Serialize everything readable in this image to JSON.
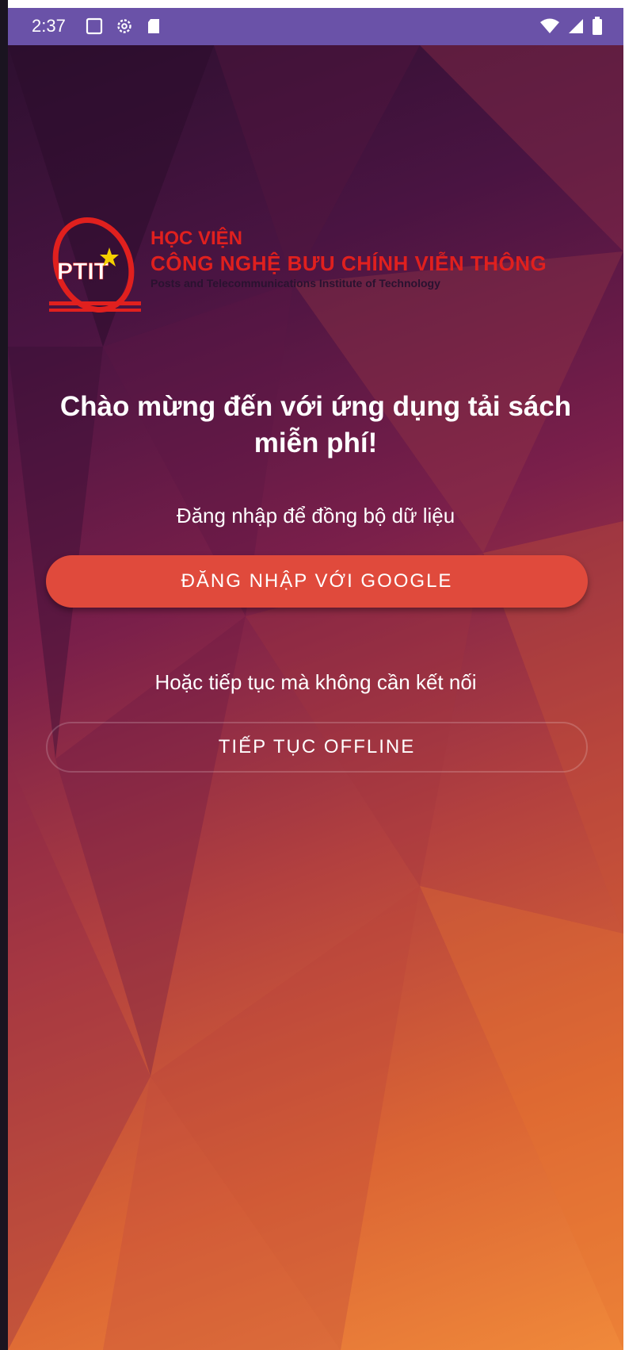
{
  "status_bar": {
    "time": "2:37",
    "left_icons": [
      "screenshot-icon",
      "settings-icon",
      "sd-card-icon"
    ],
    "right_icons": [
      "wifi-icon",
      "signal-icon",
      "battery-icon"
    ],
    "color": "#6a52a8"
  },
  "logo": {
    "mark": "PTIT",
    "line1": "HỌC VIỆN",
    "line2": "CÔNG NGHỆ BƯU CHÍNH VIỄN THÔNG",
    "line3": "Posts and Telecommunications Institute of Technology",
    "color": "#e0201e"
  },
  "welcome": {
    "title": "Chào mừng đến với ứng dụng tải sách miễn phí!",
    "login_prompt": "Đăng nhập để đồng bộ dữ liệu",
    "google_button": "ĐĂNG NHẬP VỚI GOOGLE",
    "offline_prompt": "Hoặc tiếp tục mà không cần kết nối",
    "offline_button": "TIẾP TỤC OFFLINE"
  },
  "colors": {
    "google_button": "#e04a3c",
    "background_top": "#2a0f2e",
    "background_bottom": "#f0893a"
  }
}
